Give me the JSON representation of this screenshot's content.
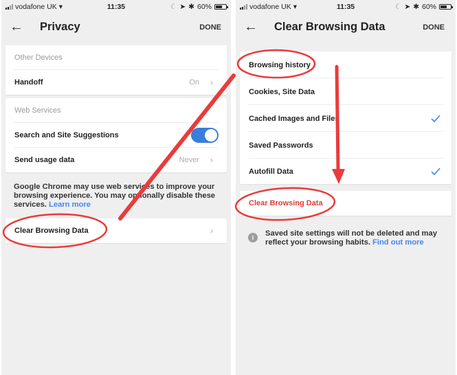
{
  "status_bar": {
    "carrier": "vodafone UK",
    "time": "11:35",
    "battery": "60%",
    "battery_level": 0.6
  },
  "left_screen": {
    "nav": {
      "back_icon": "arrow-left-icon",
      "title": "Privacy",
      "done_label": "DONE"
    },
    "other_devices": {
      "header": "Other Devices",
      "handoff": {
        "label": "Handoff",
        "value": "On"
      }
    },
    "web_services": {
      "header": "Web Services",
      "search_suggestions": {
        "label": "Search and Site Suggestions",
        "enabled": true
      },
      "send_usage": {
        "label": "Send usage data",
        "value": "Never"
      }
    },
    "description": "Google Chrome may use web services to improve your browsing experience. You may optionally disable these services.",
    "learn_more": "Learn more",
    "clear_browsing_data": "Clear Browsing Data"
  },
  "right_screen": {
    "nav": {
      "back_icon": "arrow-left-icon",
      "title": "Clear Browsing Data",
      "done_label": "DONE"
    },
    "items": [
      {
        "label": "Browsing history",
        "checked": false
      },
      {
        "label": "Cookies, Site Data",
        "checked": false
      },
      {
        "label": "Cached Images and Files",
        "checked": true
      },
      {
        "label": "Saved Passwords",
        "checked": false
      },
      {
        "label": "Autofill Data",
        "checked": true
      }
    ],
    "clear_button": "Clear Browsing Data",
    "footer_text": "Saved site settings will not be deleted and may reflect your browsing habits.",
    "find_out_more": "Find out more"
  },
  "colors": {
    "accent_blue": "#4285f4",
    "toggle_blue": "#3b7ddd",
    "destructive_red": "#e53935",
    "annotation_red": "#ea3b3b"
  }
}
